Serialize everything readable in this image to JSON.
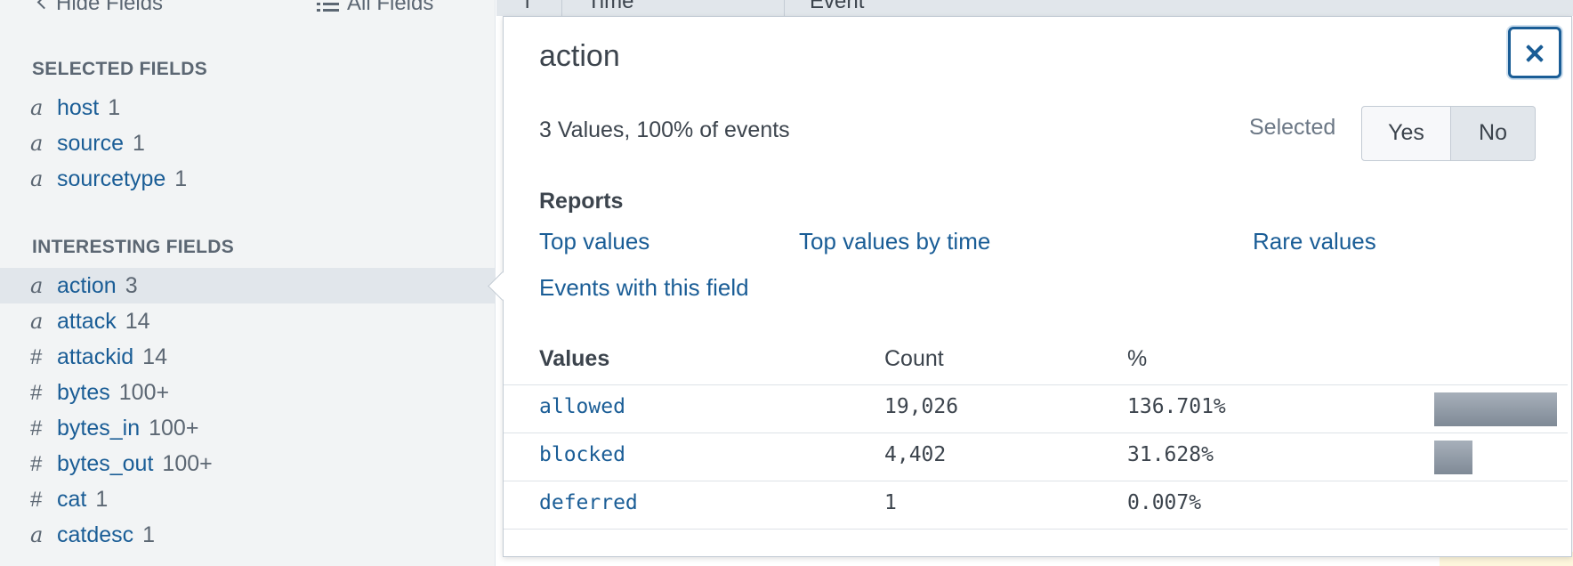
{
  "sidebar": {
    "hide_fields_label": "Hide Fields",
    "all_fields_label": "All Fields",
    "selected_title": "SELECTED FIELDS",
    "interesting_title": "INTERESTING FIELDS",
    "selected_fields": [
      {
        "type": "a",
        "name": "host",
        "count": "1"
      },
      {
        "type": "a",
        "name": "source",
        "count": "1"
      },
      {
        "type": "a",
        "name": "sourcetype",
        "count": "1"
      }
    ],
    "interesting_fields": [
      {
        "type": "a",
        "name": "action",
        "count": "3"
      },
      {
        "type": "a",
        "name": "attack",
        "count": "14"
      },
      {
        "type": "#",
        "name": "attackid",
        "count": "14"
      },
      {
        "type": "#",
        "name": "bytes",
        "count": "100+"
      },
      {
        "type": "#",
        "name": "bytes_in",
        "count": "100+"
      },
      {
        "type": "#",
        "name": "bytes_out",
        "count": "100+"
      },
      {
        "type": "#",
        "name": "cat",
        "count": "1"
      },
      {
        "type": "a",
        "name": "catdesc",
        "count": "1"
      }
    ]
  },
  "table_header": {
    "col_num": "i",
    "col_time": "Time",
    "col_event": "Event"
  },
  "popup": {
    "field_name": "action",
    "summary": "3 Values, 100% of events",
    "selected_label": "Selected",
    "yes_label": "Yes",
    "no_label": "No",
    "selected_value": "No",
    "reports_heading": "Reports",
    "reports": {
      "top_values": "Top values",
      "top_values_by_time": "Top values by time",
      "rare_values": "Rare values",
      "events_with_field": "Events with this field"
    },
    "values_table": {
      "headers": {
        "values": "Values",
        "count": "Count",
        "percent": "%"
      },
      "rows": [
        {
          "value": "allowed",
          "count": "19,026",
          "percent": "136.701%",
          "bar_fraction": 1.0
        },
        {
          "value": "blocked",
          "count": "4,402",
          "percent": "31.628%",
          "bar_fraction": 0.3128
        },
        {
          "value": "deferred",
          "count": "1",
          "percent": "0.007%",
          "bar_fraction": 0.0
        }
      ]
    }
  },
  "colors": {
    "link": "#1a5d96",
    "sidebar_bg": "#f2f4f5",
    "active_row": "#e1e6eb",
    "text": "#3c444d"
  },
  "icons": [
    "chevron-left-icon",
    "list-icon",
    "close-icon"
  ]
}
